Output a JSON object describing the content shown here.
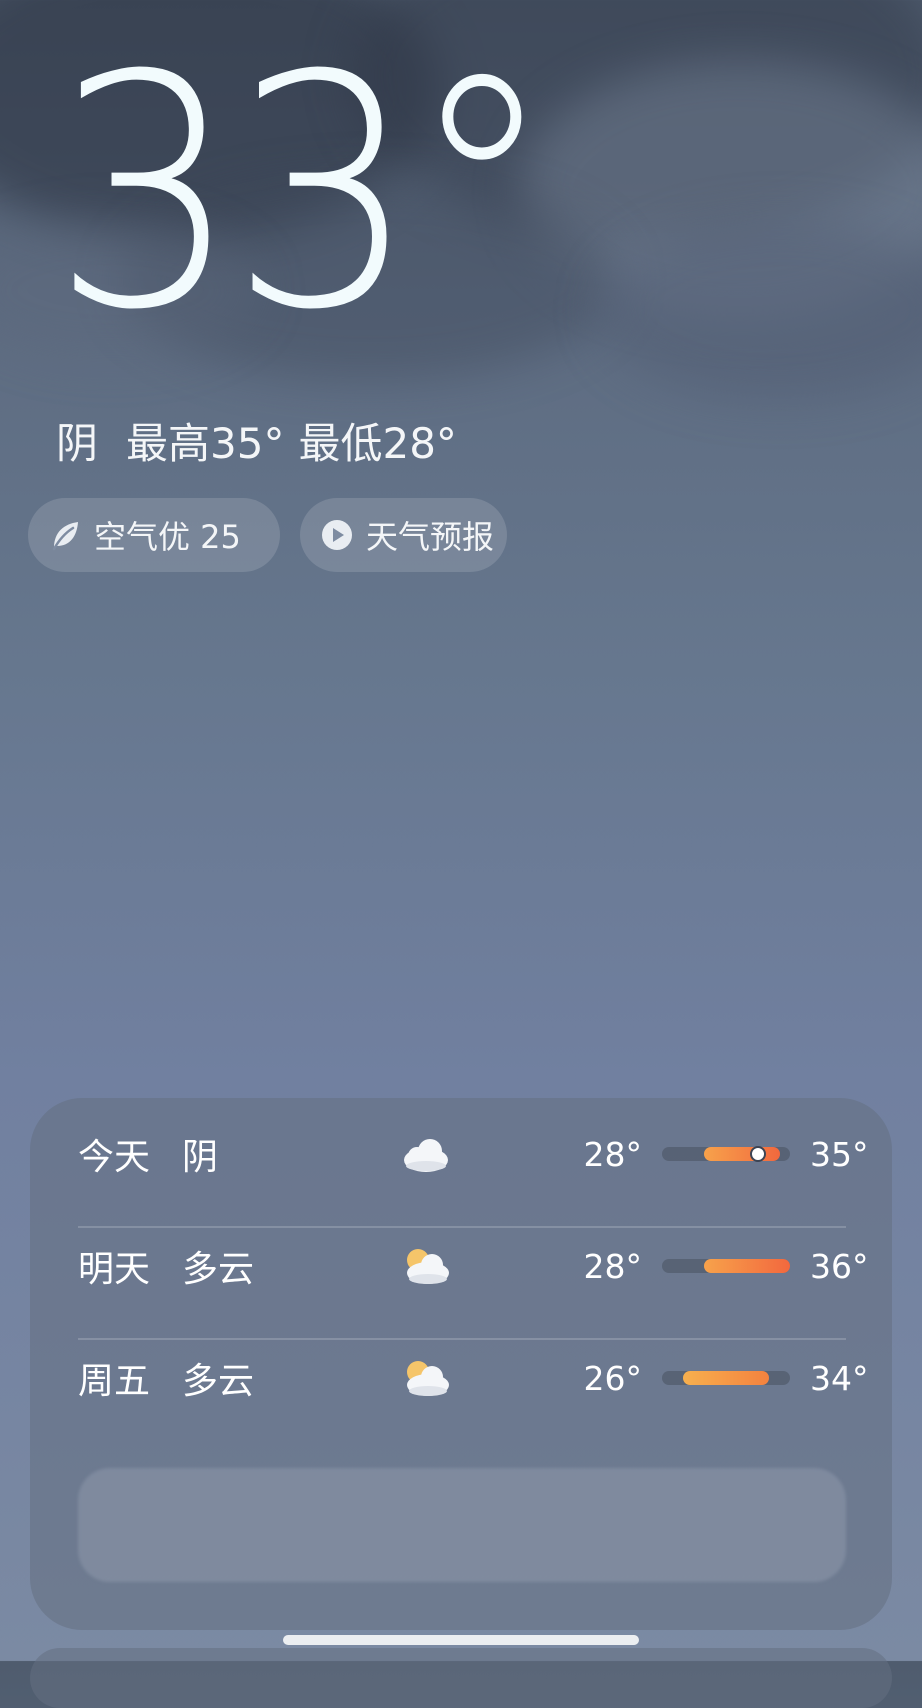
{
  "current": {
    "temperature": "33°",
    "condition": "阴",
    "high": "最高35°",
    "low": "最低28°"
  },
  "chips": {
    "air_quality": "空气优 25",
    "forecast": "天气预报"
  },
  "icons": {
    "air": "leaf-icon",
    "forecast": "play-icon"
  },
  "daily": [
    {
      "day": "今天",
      "condition": "阴",
      "icon": "cloud-icon",
      "low": "28°",
      "high": "35°",
      "current_marker": true
    },
    {
      "day": "明天",
      "condition": "多云",
      "icon": "partly-cloudy-icon",
      "low": "28°",
      "high": "36°"
    },
    {
      "day": "周五",
      "condition": "多云",
      "icon": "partly-cloudy-icon",
      "low": "26°",
      "high": "34°"
    }
  ],
  "colors": {
    "bar_start": "#f7a24b",
    "bar_end": "#f2683e",
    "sun": "#f5c56a"
  }
}
